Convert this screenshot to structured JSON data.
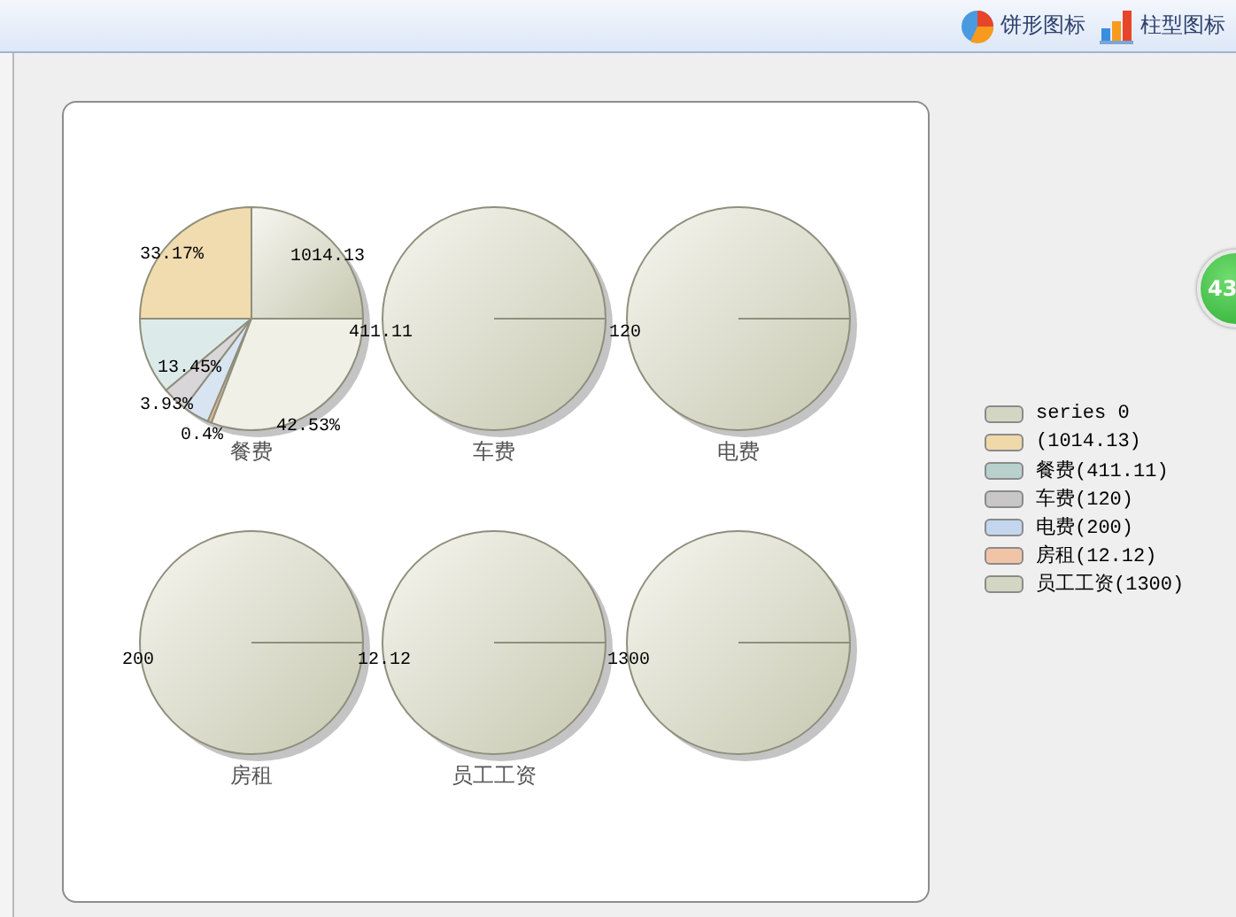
{
  "toolbar": [
    {
      "kind": "pie",
      "label": "饼形图标"
    },
    {
      "kind": "bar",
      "label": "柱型图标"
    }
  ],
  "pies": [
    {
      "kind": "pie",
      "title": "餐费",
      "labels": [
        "1014.13",
        "33.17%",
        "411.11",
        "13.45%",
        "3.93%",
        "0.4%",
        "42.53%"
      ]
    },
    {
      "kind": "pie",
      "title": "车费",
      "labels": [
        "120"
      ]
    },
    {
      "kind": "pie",
      "title": "电费"
    },
    {
      "kind": "pie",
      "title": "房租",
      "labels": [
        "200",
        "12.12"
      ]
    },
    {
      "kind": "pie",
      "title": "员工工资",
      "labels": [
        "1300"
      ]
    },
    {
      "kind": "pie"
    }
  ],
  "legend": [
    {
      "label": "series 0",
      "color": "#d4d6c4"
    },
    {
      "label": "(1014.13)",
      "color": "#f0d9a8"
    },
    {
      "label": "餐费(411.11)",
      "color": "#b9d1cc"
    },
    {
      "label": "车费(120)",
      "color": "#c9c6c8"
    },
    {
      "label": "电费(200)",
      "color": "#c4d6ee"
    },
    {
      "label": "房租(12.12)",
      "color": "#f2c4a6"
    },
    {
      "label": "员工工资(1300)",
      "color": "#d4d6c4"
    }
  ],
  "badge": "43"
}
